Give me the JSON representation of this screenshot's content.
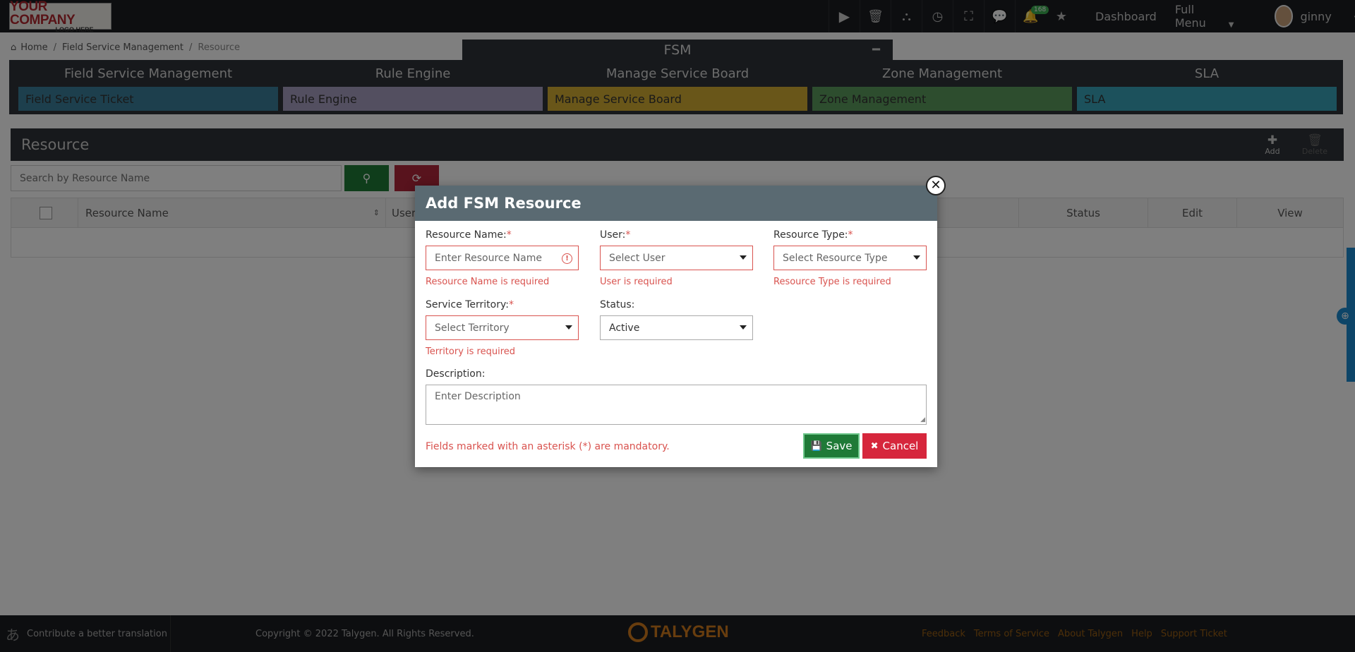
{
  "header": {
    "logo_line1": "YOUR COMPANY",
    "logo_line2": "LOGO HERE",
    "icons": [
      "play-icon",
      "trash-icon",
      "org-chart-icon",
      "clock-icon",
      "fullscreen-icon",
      "chat-icon",
      "bell-icon",
      "star-icon"
    ],
    "notification_count": "168",
    "dashboard_label": "Dashboard",
    "full_menu_label": "Full Menu",
    "user_name": "ginny"
  },
  "breadcrumb": {
    "home": "Home",
    "section": "Field Service Management",
    "current": "Resource"
  },
  "fsm_panel": {
    "title": "FSM",
    "columns": [
      {
        "title": "Field Service Management",
        "item": "Field Service Ticket",
        "color": "#3b7f9b"
      },
      {
        "title": "Rule Engine",
        "item": "Rule Engine",
        "color": "#a79ec0"
      },
      {
        "title": "Manage Service Board",
        "item": "Manage Service Board",
        "color": "#d3ad32"
      },
      {
        "title": "Zone Management",
        "item": "Zone Management",
        "color": "#5b9a5c"
      },
      {
        "title": "SLA",
        "item": "SLA",
        "color": "#38a2b8"
      }
    ]
  },
  "resource": {
    "title": "Resource",
    "add_label": "Add",
    "delete_label": "Delete",
    "search_placeholder": "Search by Resource Name",
    "columns": {
      "name": "Resource Name",
      "user": "User",
      "status": "Status",
      "edit": "Edit",
      "view": "View"
    }
  },
  "modal": {
    "title": "Add FSM Resource",
    "resource_name": {
      "label": "Resource Name:",
      "placeholder": "Enter Resource Name",
      "error": "Resource Name is required"
    },
    "user": {
      "label": "User:",
      "value": "Select User",
      "error": "User is required"
    },
    "resource_type": {
      "label": "Resource Type:",
      "value": "Select Resource Type",
      "error": "Resource Type is required"
    },
    "territory": {
      "label": "Service Territory:",
      "value": "Select Territory",
      "error": "Territory is required"
    },
    "status": {
      "label": "Status:",
      "value": "Active"
    },
    "description": {
      "label": "Description:",
      "placeholder": "Enter Description"
    },
    "mandatory_note": "Fields marked with an asterisk (*) are mandatory.",
    "save_label": "Save",
    "cancel_label": "Cancel",
    "required_mark": "*"
  },
  "footer": {
    "translate": "Contribute a better translation",
    "copyright": "Copyright © 2022 Talygen. All Rights Reserved.",
    "brand": "TALYGEN",
    "links": [
      "Feedback",
      "Terms of Service",
      "About Talygen",
      "Help",
      "Support Ticket"
    ]
  }
}
